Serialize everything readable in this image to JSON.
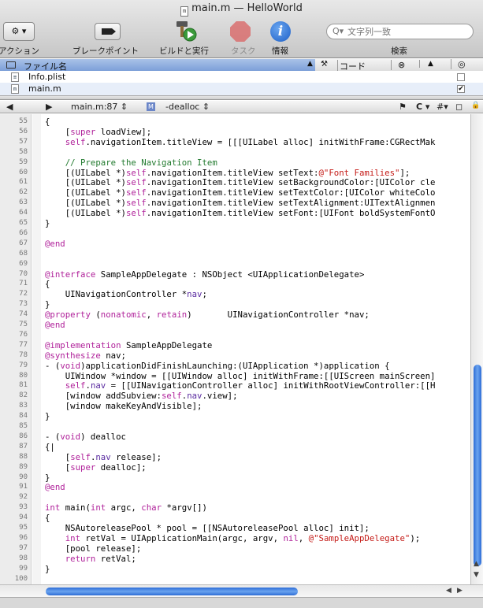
{
  "window": {
    "title": "main.m — HelloWorld",
    "doc_icon": "m"
  },
  "toolbar": {
    "action_label": "アクション",
    "action_button": "⚙ ▾",
    "breakpoints_label": "ブレークポイント",
    "build_run_label": "ビルドと実行",
    "tasks_label": "タスク",
    "info_label": "情報",
    "info_glyph": "i",
    "search_label": "検索",
    "search_placeholder": "文字列一致",
    "search_icon": "Q▾"
  },
  "file_list": {
    "headers": {
      "name": "ファイル名",
      "code": "コード",
      "build_icon": "hammer-icon",
      "error_icon": "⊗",
      "warning_icon": "▲",
      "target_icon": "◎"
    },
    "rows": [
      {
        "icon": "plist-file-icon",
        "icon_glyph": "≡",
        "name": "Info.plist",
        "checked": ""
      },
      {
        "icon": "m-file-icon",
        "icon_glyph": "m",
        "name": "main.m",
        "checked": "✔"
      }
    ]
  },
  "nav_bar": {
    "back": "◀",
    "forward": "▶",
    "file_popup": "main.m:87 ⇕",
    "func_popup": "-dealloc ⇕",
    "bookmark_glyph": "⚑",
    "lang_popup": "C ▾",
    "include_glyph": "#▾",
    "counterpart_glyph": "◻",
    "m_badge": "M",
    "lock_glyph": "🔒"
  },
  "code": {
    "lines": [
      {
        "n": "55",
        "html": "{"
      },
      {
        "n": "56",
        "html": "    [<span class=\"kw\">super</span> loadView];"
      },
      {
        "n": "57",
        "html": "    <span class=\"kw\">self</span>.navigationItem.titleView = [[[UILabel alloc] initWithFrame:CGRectMak"
      },
      {
        "n": "58",
        "html": ""
      },
      {
        "n": "59",
        "html": "    <span class=\"cm\">// Prepare the Navigation Item</span>"
      },
      {
        "n": "60",
        "html": "    [(UILabel *)<span class=\"kw\">self</span>.navigationItem.titleView setText:<span class=\"str\">@\"Font Families\"</span>];"
      },
      {
        "n": "61",
        "html": "    [(UILabel *)<span class=\"kw\">self</span>.navigationItem.titleView setBackgroundColor:[UIColor cle"
      },
      {
        "n": "62",
        "html": "    [(UILabel *)<span class=\"kw\">self</span>.navigationItem.titleView setTextColor:[UIColor whiteColo"
      },
      {
        "n": "63",
        "html": "    [(UILabel *)<span class=\"kw\">self</span>.navigationItem.titleView setTextAlignment:UITextAlignmen"
      },
      {
        "n": "64",
        "html": "    [(UILabel *)<span class=\"kw\">self</span>.navigationItem.titleView setFont:[UIFont boldSystemFontO"
      },
      {
        "n": "65",
        "html": "}"
      },
      {
        "n": "66",
        "html": ""
      },
      {
        "n": "67",
        "html": "<span class=\"kw\">@end</span>"
      },
      {
        "n": "68",
        "html": ""
      },
      {
        "n": "69",
        "html": ""
      },
      {
        "n": "70",
        "html": "<span class=\"kw\">@interface</span> SampleAppDelegate : NSObject &lt;UIApplicationDelegate&gt;"
      },
      {
        "n": "71",
        "html": "{"
      },
      {
        "n": "72",
        "html": "    UINavigationController *<span class=\"cls\">nav</span>;"
      },
      {
        "n": "73",
        "html": "}"
      },
      {
        "n": "74",
        "html": "<span class=\"kw\">@property</span> (<span class=\"kw\">nonatomic</span>, <span class=\"kw\">retain</span>)       UINavigationController *nav;"
      },
      {
        "n": "75",
        "html": "<span class=\"kw\">@end</span>"
      },
      {
        "n": "76",
        "html": ""
      },
      {
        "n": "77",
        "html": "<span class=\"kw\">@implementation</span> SampleAppDelegate"
      },
      {
        "n": "78",
        "html": "<span class=\"kw\">@synthesize</span> nav;"
      },
      {
        "n": "79",
        "html": "- (<span class=\"kw\">void</span>)applicationDidFinishLaunching:(UIApplication *)application {"
      },
      {
        "n": "80",
        "html": "    UIWindow *window = [[UIWindow alloc] initWithFrame:[[UIScreen mainScreen]"
      },
      {
        "n": "81",
        "html": "    <span class=\"kw\">self</span>.<span class=\"cls\">nav</span> = [[UINavigationController alloc] initWithRootViewController:[[H"
      },
      {
        "n": "82",
        "html": "    [window addSubview:<span class=\"kw\">self</span>.<span class=\"cls\">nav</span>.view];"
      },
      {
        "n": "83",
        "html": "    [window makeKeyAndVisible];"
      },
      {
        "n": "84",
        "html": "}"
      },
      {
        "n": "85",
        "html": ""
      },
      {
        "n": "86",
        "html": "- (<span class=\"kw\">void</span>) dealloc"
      },
      {
        "n": "87",
        "html": "{|"
      },
      {
        "n": "88",
        "html": "    [<span class=\"kw\">self</span>.<span class=\"cls\">nav</span> release];"
      },
      {
        "n": "89",
        "html": "    [<span class=\"kw\">super</span> dealloc];"
      },
      {
        "n": "90",
        "html": "}"
      },
      {
        "n": "91",
        "html": "<span class=\"kw\">@end</span>"
      },
      {
        "n": "92",
        "html": ""
      },
      {
        "n": "93",
        "html": "<span class=\"kw\">int</span> main(<span class=\"kw\">int</span> argc, <span class=\"kw\">char</span> *argv[])"
      },
      {
        "n": "94",
        "html": "{"
      },
      {
        "n": "95",
        "html": "    NSAutoreleasePool * pool = [[NSAutoreleasePool alloc] init];"
      },
      {
        "n": "96",
        "html": "    <span class=\"kw\">int</span> retVal = UIApplicationMain(argc, argv, <span class=\"kw\">nil</span>, <span class=\"str\">@\"SampleAppDelegate\"</span>);"
      },
      {
        "n": "97",
        "html": "    [pool release];"
      },
      {
        "n": "98",
        "html": "    <span class=\"kw\">return</span> retVal;"
      },
      {
        "n": "99",
        "html": "}"
      },
      {
        "n": "100",
        "html": ""
      }
    ]
  },
  "colors": {
    "keyword": "#b0219a",
    "comment": "#217a2e",
    "string": "#c41a16",
    "ivar": "#5a2ba0",
    "selection_header": "#7c9fd8",
    "scroll_thumb": "#2d6dd6"
  }
}
